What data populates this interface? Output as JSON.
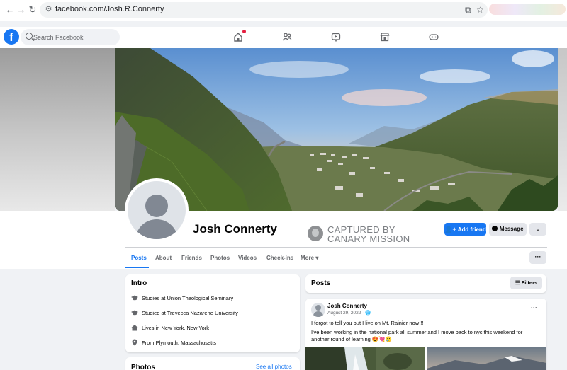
{
  "browser": {
    "url": "facebook.com/Josh.R.Connerty",
    "back_icon": "back-arrow-icon",
    "forward_icon": "forward-arrow-icon",
    "reload_icon": "reload-icon"
  },
  "header": {
    "search_placeholder": "Search Facebook",
    "notification_color": "#e41e3f"
  },
  "profile": {
    "name": "Josh Connerty",
    "watermark_line1": "CAPTURED BY",
    "watermark_line2": "CANARY MISSION",
    "add_friend_label": "Add friend",
    "message_label": "Message",
    "accent_color": "#1877f2"
  },
  "tabs": [
    {
      "label": "Posts"
    },
    {
      "label": "About"
    },
    {
      "label": "Friends"
    },
    {
      "label": "Photos"
    },
    {
      "label": "Videos"
    },
    {
      "label": "Check-ins"
    },
    {
      "label": "More"
    }
  ],
  "intro": {
    "title": "Intro",
    "items": [
      {
        "prefix": "Studies at Union Theological Seminary",
        "value": ""
      },
      {
        "prefix": "Studied at ",
        "value": "Trevecca Nazarene University"
      },
      {
        "prefix": "Lives in ",
        "value": "New York, New York"
      },
      {
        "prefix": "From ",
        "value": "Plymouth, Massachusetts"
      }
    ]
  },
  "photos_section": {
    "title": "Photos",
    "see_all": "See all photos"
  },
  "posts_section": {
    "title": "Posts",
    "filters_label": "Filters"
  },
  "post": {
    "author": "Josh Connerty",
    "date": "August 29, 2022 · ",
    "text1": "I forgot to tell you but I live on Mt. Rainier now !!",
    "text2": "I've been working in the national park all summer and I move back to nyc this weekend for another round of learning 😍💘🥲"
  }
}
